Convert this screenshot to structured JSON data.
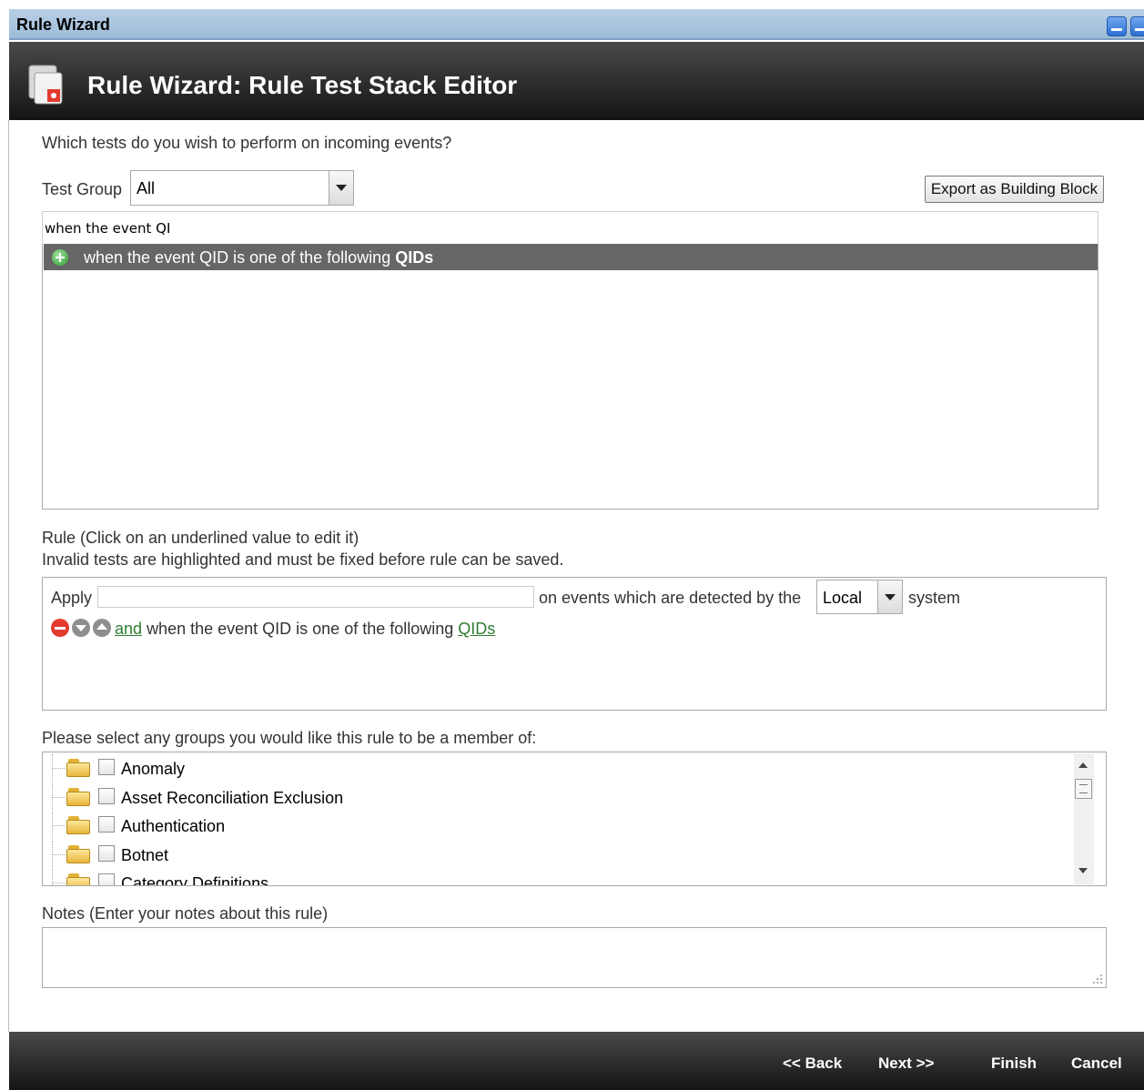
{
  "window": {
    "title": "Rule Wizard"
  },
  "header": {
    "title": "Rule Wizard: Rule Test Stack Editor"
  },
  "prompt": "Which tests do you wish to perform on incoming events?",
  "test_group": {
    "label": "Test Group",
    "selected": "All"
  },
  "export_button": "Export as Building Block",
  "filter": {
    "value": "when the event QI"
  },
  "test_list": {
    "items": [
      {
        "prefix": "when the event QID is one of the following",
        "emphasis": "QIDs"
      }
    ]
  },
  "rule": {
    "instruction_1": "Rule (Click on an underlined value to edit it)",
    "instruction_2": "Invalid tests are highlighted and must be fixed before rule can be saved.",
    "apply_label": "Apply",
    "apply_value": "",
    "detected_text": "on events which are detected by the",
    "system_select": "Local",
    "system_label": "system",
    "and_link": "and",
    "test_text": "when the event QID is one of the following",
    "qids_link": "QIDs"
  },
  "groups": {
    "prompt": "Please select any groups you would like this rule to be a member of:",
    "items": [
      "Anomaly",
      "Asset Reconciliation Exclusion",
      "Authentication",
      "Botnet",
      "Category Definitions"
    ]
  },
  "notes": {
    "label": "Notes (Enter your notes about this rule)",
    "value": ""
  },
  "footer": {
    "back": "<< Back",
    "next": "Next >>",
    "finish": "Finish",
    "cancel": "Cancel"
  },
  "colors": {
    "header_bg": "#1c1c1c",
    "titlebar_bg": "#a9c3de",
    "selected_row": "#666666",
    "link": "#2e7d32",
    "remove": "#e23b2e"
  }
}
